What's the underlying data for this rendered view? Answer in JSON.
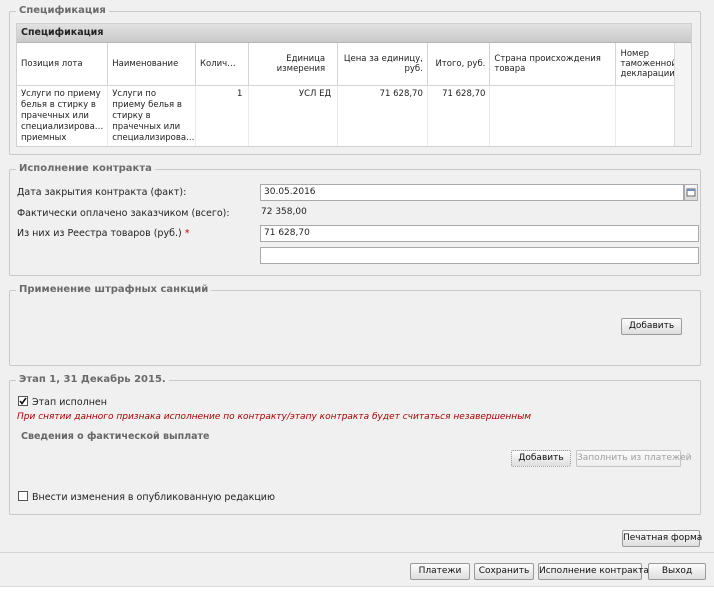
{
  "spec_section": {
    "legend": "Спецификация",
    "grid_title": "Спецификация",
    "columns": [
      "Позиция лота",
      "Наименование",
      "Колич…",
      "Единица измерения",
      "Цена за единицу, руб.",
      "Итого, руб.",
      "Страна происхождения товара",
      "Номер таможенной декларации"
    ],
    "rows": [
      [
        "Услуги по приему белья в стирку в прачечных или специализирова… приемных пунктах",
        "Услуги по приему белья в стирку в прачечных или специализирова… приемных пунктах",
        "1",
        "УСЛ ЕД",
        "71 628,70",
        "71 628,70",
        "",
        ""
      ]
    ]
  },
  "contract": {
    "legend": "Исполнение контракта",
    "close_date_label": "Дата закрытия контракта (факт):",
    "close_date_value": "30.05.2016",
    "paid_label": "Фактически оплачено заказчиком (всего):",
    "paid_value": "72 358,00",
    "registry_label": "Из них из Реестра товаров (руб.)",
    "required_mark": "*",
    "registry_value": "71 628,70",
    "extra_value": ""
  },
  "penalties": {
    "legend": "Применение штрафных санкций",
    "add_label": "Добавить"
  },
  "stage": {
    "legend": "Этап 1, 31 Декабрь 2015.",
    "done_label": "Этап исполнен",
    "done_checked": true,
    "warning": "При снятии данного признака исполнение по контракту/этапу контракта будет считаться незавершенным",
    "payment_title": "Сведения о фактической выплате",
    "add_label": "Добавить",
    "fill_label": "Заполнить из платежей",
    "edit_label": "Внести изменения в опубликованную редакцию",
    "edit_checked": false
  },
  "print_label": "Печатная форма",
  "footer": {
    "payments": "Платежи",
    "save": "Сохранить",
    "execution": "Исполнение контракта",
    "exit": "Выход"
  }
}
